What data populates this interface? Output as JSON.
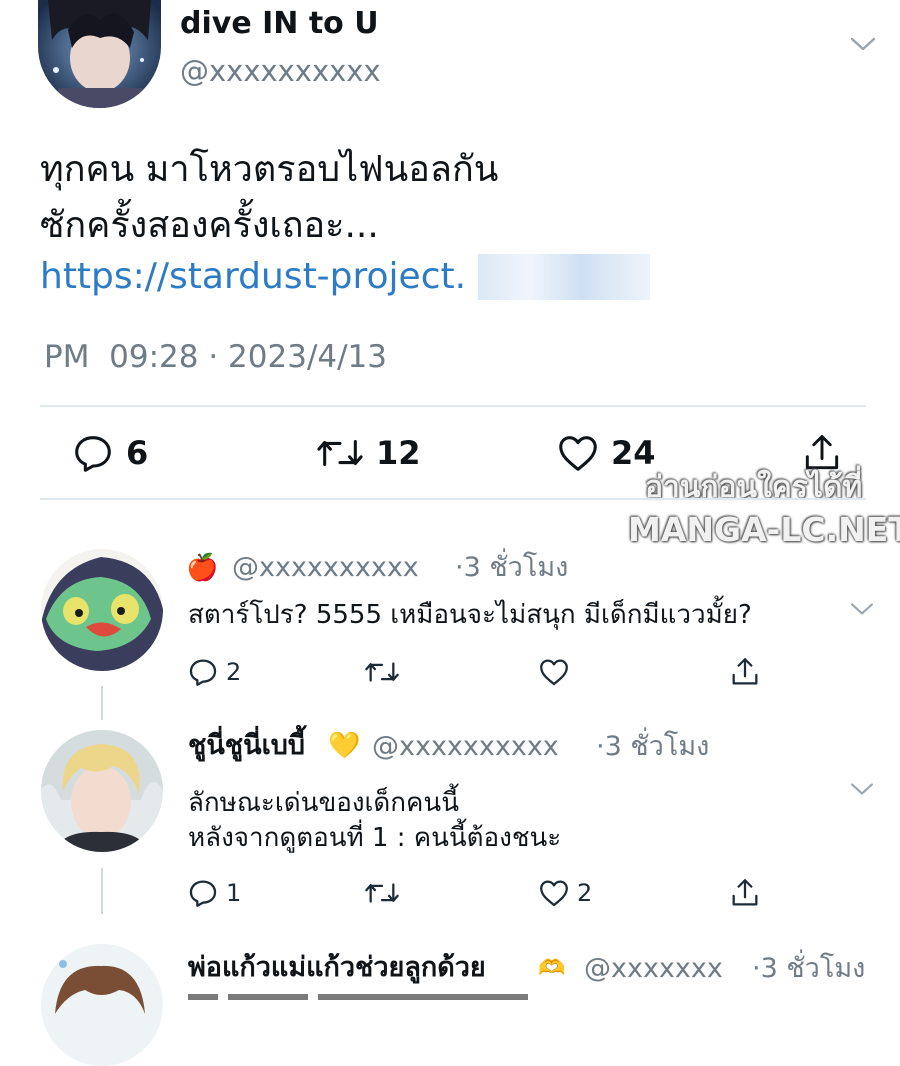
{
  "tweet": {
    "display_name": "dive IN to U",
    "handle": "@xxxxxxxxxx",
    "text_line1": "ทุกคน มาโหวตรอบไฟนอลกัน",
    "text_line2": "ซักครั้งสองครั้งเถอะ...",
    "link": "https://stardust-project.",
    "timestamp": "PM  09:28 · 2023/4/13",
    "stats": {
      "replies": "6",
      "retweets": "12",
      "likes": "24"
    }
  },
  "watermark": {
    "line1": "อ่านก่อนใครได้ที่",
    "line2": "MANGA-LC.NET"
  },
  "replies": [
    {
      "name_emoji": "🍎",
      "name": "",
      "handle": "@xxxxxxxxxx",
      "time": "·3 ชั่วโมง",
      "text_lines": [
        "สตาร์โปร? 5555 เหมือนจะไม่สนุก มีเด็กมีแววมั้ย?"
      ],
      "reply_count": "2",
      "retweet_count": "",
      "like_count": ""
    },
    {
      "name": "ชูนี่ชูนี่เบบี้",
      "name_emoji": "💛",
      "handle": "@xxxxxxxxxx",
      "time": "·3 ชั่วโมง",
      "text_lines": [
        "ลักษณะเด่นของเด็กคนนี้",
        "หลังจากดูตอนที่ 1 : คนนี้ต้องชนะ"
      ],
      "reply_count": "1",
      "retweet_count": "",
      "like_count": "2"
    },
    {
      "name": "พ่อแก้วแม่แก้วช่วยลูกด้วย",
      "name_emoji": "🫶",
      "handle": "@xxxxxxx",
      "time": "·3 ชั่วโมง"
    }
  ],
  "colors": {
    "link": "#2d7bc4",
    "secondary_text": "#6f7b85",
    "divider": "#e1e8ed",
    "thread_line": "#cfd9de"
  },
  "icons": [
    "chevron-down-icon",
    "reply-icon",
    "retweet-icon",
    "like-icon",
    "share-icon"
  ]
}
